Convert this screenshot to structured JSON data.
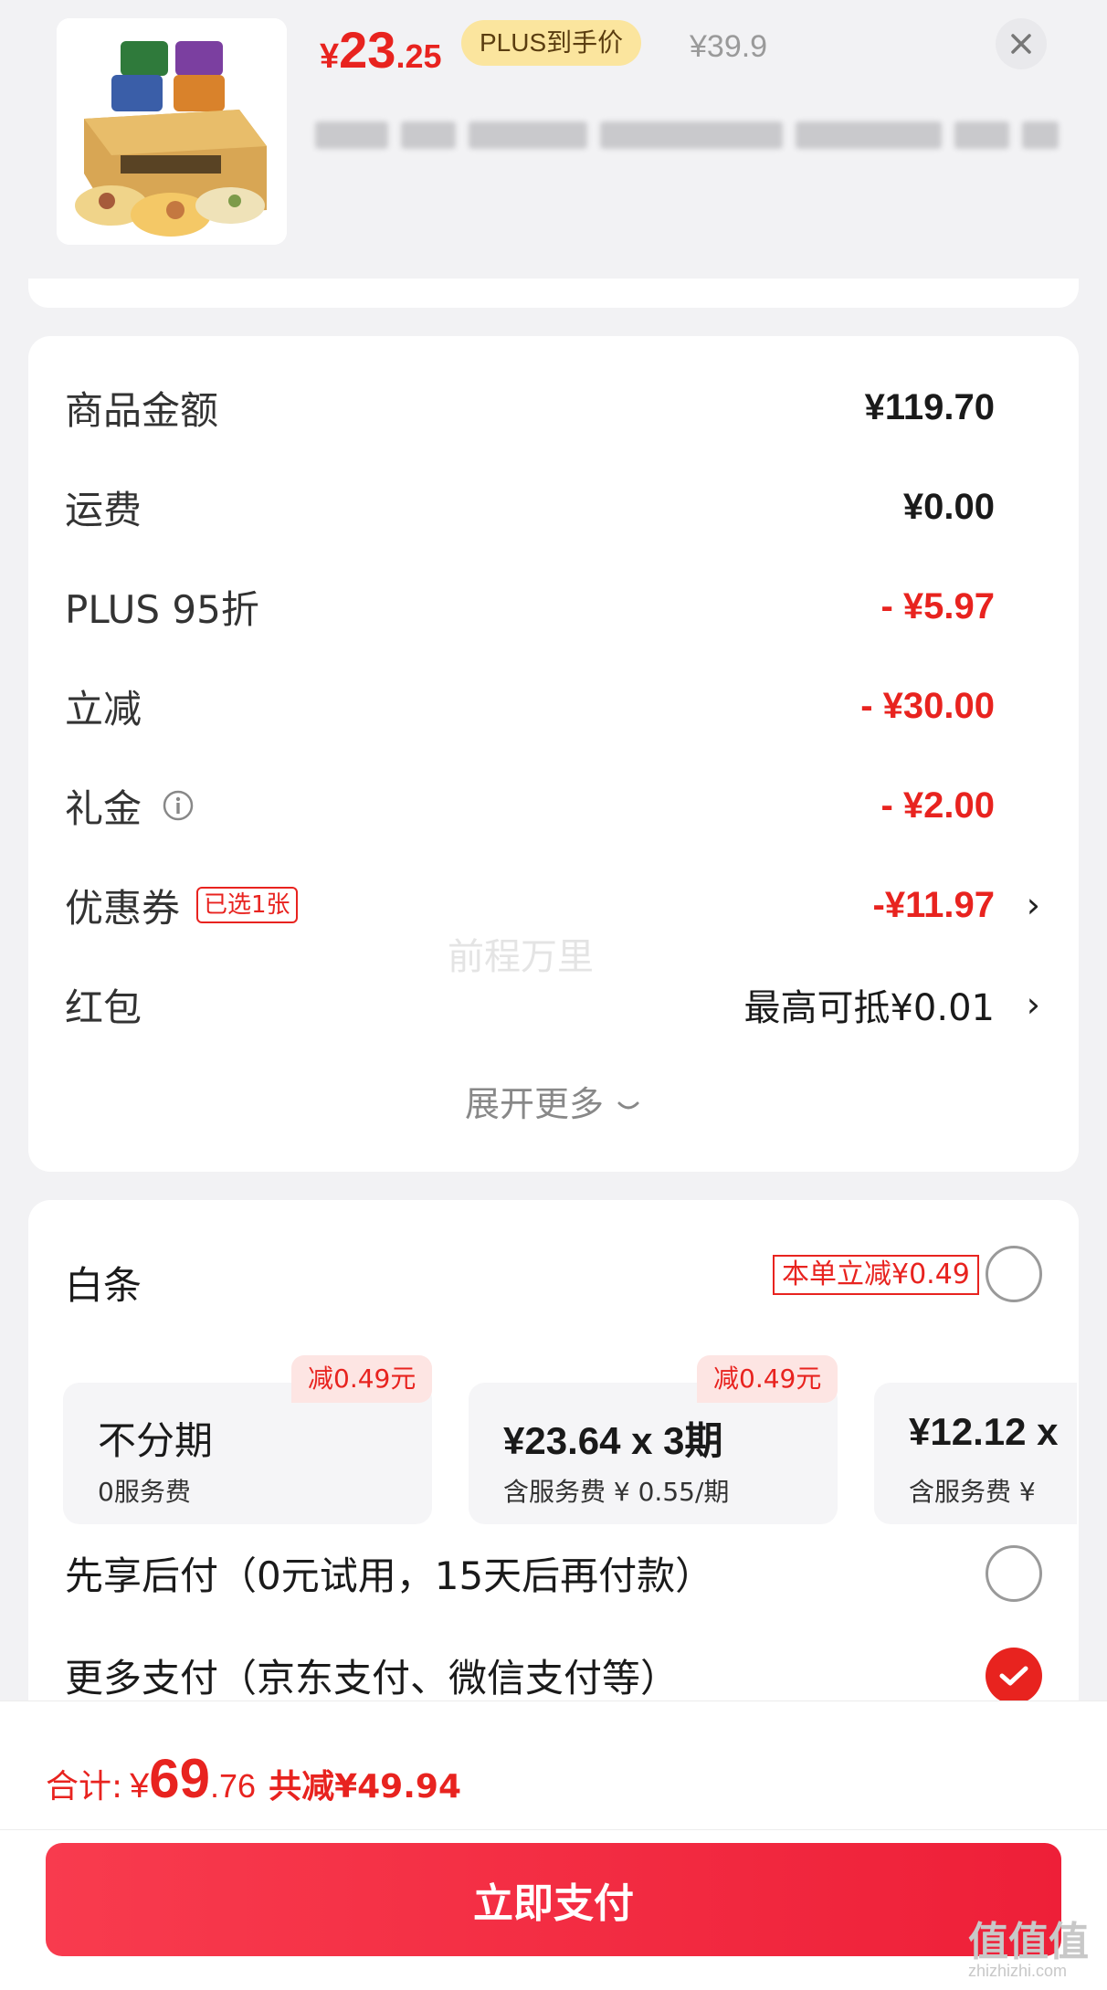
{
  "product": {
    "price_currency": "¥",
    "price_int": "23",
    "price_dec": ".25",
    "plus_badge": "PLUS到手价",
    "original_price": "¥39.9"
  },
  "summary": {
    "rows": [
      {
        "label": "商品金额",
        "value": "¥119.70"
      },
      {
        "label": "运费",
        "value": "¥0.00"
      },
      {
        "label": "PLUS 95折",
        "value": "- ¥5.97"
      },
      {
        "label": "立减",
        "value": "- ¥30.00"
      },
      {
        "label": "礼金",
        "value": "- ¥2.00"
      },
      {
        "label": "优惠券",
        "tag": "已选1张",
        "value": "-¥11.97"
      },
      {
        "label": "红包",
        "value": "最高可抵¥0.01"
      }
    ],
    "expand_label": "展开更多",
    "expand_chevron": "›",
    "row_chevron": "›"
  },
  "watermark": "前程万里",
  "payment": {
    "baitiao_label": "白条",
    "baitiao_promo": "本单立减¥0.49",
    "installments": [
      {
        "badge": "减0.49元",
        "main": "不分期",
        "sub": "0服务费"
      },
      {
        "badge": "减0.49元",
        "main": "¥23.64 x 3期",
        "sub": "含服务费 ¥ 0.55/期"
      },
      {
        "badge": "",
        "main": "¥12.12 x",
        "sub": "含服务费 ¥"
      }
    ],
    "option_pay_later": "先享后付（0元试用，15天后再付款）",
    "option_more": "更多支付（京东支付、微信支付等）"
  },
  "footer": {
    "total_label": "合计:",
    "total_currency": "¥",
    "total_int": "69",
    "total_dec": ".76",
    "saved": "共减¥49.94",
    "pay_button": "立即支付"
  },
  "brand": {
    "mark": "值值值",
    "site": "zhizhizhi.com"
  },
  "colors": {
    "accent_red": "#e8231f",
    "plus_gold": "#fbe59e",
    "button_red": "#f83b4e"
  }
}
